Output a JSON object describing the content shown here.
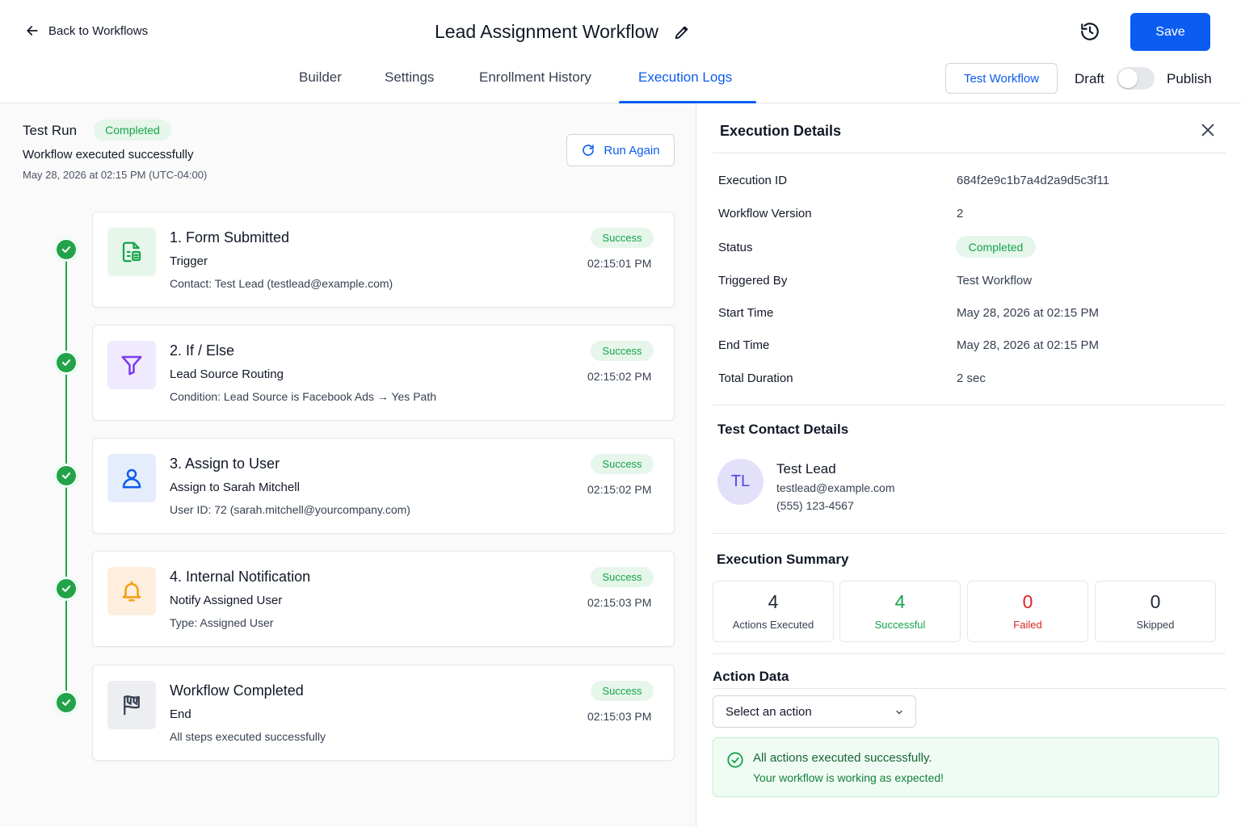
{
  "header": {
    "back_label": "Back to Workflows",
    "title": "Lead Assignment Workflow",
    "save_label": "Save",
    "test_workflow_label": "Test Workflow",
    "draft_label": "Draft",
    "publish_label": "Publish",
    "publish_toggle_on": false
  },
  "tabs": [
    {
      "label": "Builder",
      "active": false
    },
    {
      "label": "Settings",
      "active": false
    },
    {
      "label": "Enrollment History",
      "active": false
    },
    {
      "label": "Execution Logs",
      "active": true
    }
  ],
  "test_run": {
    "title": "Test Run",
    "status": "Completed",
    "message": "Workflow executed successfully",
    "date": "May 28, 2026 at 02:15 PM (UTC-04:00)",
    "run_again_label": "Run Again"
  },
  "steps": [
    {
      "title": "1. Form Submitted",
      "subtitle": "Trigger",
      "detail": "Contact:  Test Lead (testlead@example.com)",
      "status": "Success",
      "time": "02:15:01 PM",
      "icon": "form-icon"
    },
    {
      "title": "2. If / Else",
      "subtitle": "Lead Source Routing",
      "detail": "Condition:  Lead Source is Facebook Ads  →  Yes Path",
      "status": "Success",
      "time": "02:15:02 PM",
      "icon": "filter-icon"
    },
    {
      "title": "3. Assign to User",
      "subtitle": "Assign to Sarah Mitchell",
      "detail": "User ID:  72 (sarah.mitchell@yourcompany.com)",
      "status": "Success",
      "time": "02:15:02 PM",
      "icon": "user-icon"
    },
    {
      "title": "4. Internal Notification",
      "subtitle": "Notify Assigned User",
      "detail": "Type:  Assigned User",
      "status": "Success",
      "time": "02:15:03 PM",
      "icon": "bell-icon"
    },
    {
      "title": "Workflow Completed",
      "subtitle": "End",
      "detail": "All steps executed successfully",
      "status": "Success",
      "time": "02:15:03 PM",
      "icon": "flag-icon"
    }
  ],
  "details": {
    "title": "Execution Details",
    "rows": [
      {
        "label": "Execution ID",
        "value": "684f2e9c1b7a4d2a9d5c3f11"
      },
      {
        "label": "Workflow Version",
        "value": "2"
      },
      {
        "label": "Status",
        "value": "Completed"
      },
      {
        "label": "Triggered By",
        "value": "Test Workflow"
      },
      {
        "label": "Start Time",
        "value": "May 28, 2026 at 02:15 PM"
      },
      {
        "label": "End Time",
        "value": "May 28, 2026 at 02:15 PM"
      },
      {
        "label": "Total Duration",
        "value": "2 sec"
      }
    ]
  },
  "contact": {
    "section_title": "Test Contact Details",
    "initials": "TL",
    "name": "Test Lead",
    "email": "testlead@example.com",
    "phone": "(555) 123-4567"
  },
  "summary": {
    "section_title": "Execution Summary",
    "stats": [
      {
        "value": "4",
        "label": "Actions Executed",
        "color": "#1f2937",
        "label_color": "#374151"
      },
      {
        "value": "4",
        "label": "Successful",
        "color": "#16a34a",
        "label_color": "#16a34a"
      },
      {
        "value": "0",
        "label": "Failed",
        "color": "#dc2626",
        "label_color": "#dc2626"
      },
      {
        "value": "0",
        "label": "Skipped",
        "color": "#1f2937",
        "label_color": "#374151"
      }
    ]
  },
  "action_data": {
    "section_title": "Action Data",
    "select_placeholder": "Select an action",
    "success_title": "All actions executed successfully.",
    "success_text": "Your workflow is working as expected!"
  },
  "colors": {
    "accent": "#0b5cf0",
    "success": "#16a34a",
    "failed": "#dc2626"
  }
}
